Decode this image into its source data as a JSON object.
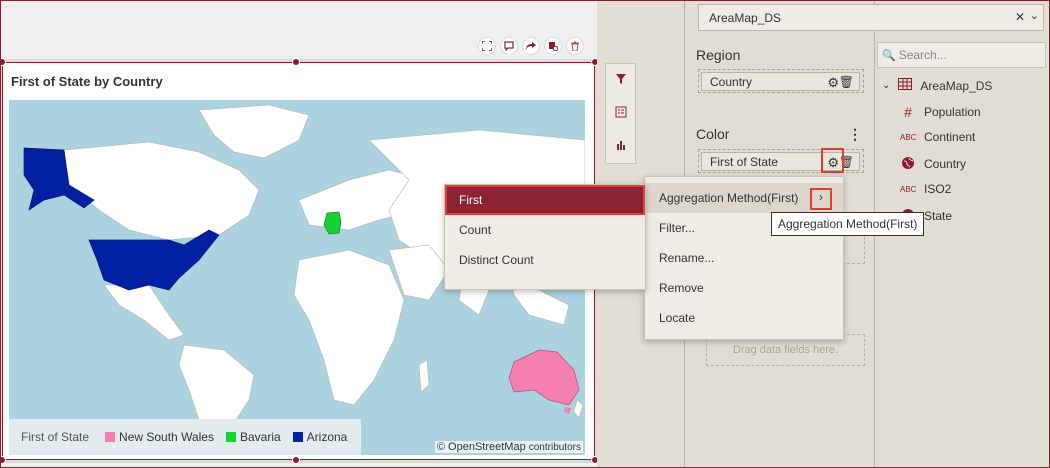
{
  "widget": {
    "title": "First of State by Country",
    "legend": {
      "title": "First of State",
      "items": [
        {
          "label": "New South Wales",
          "color": "#f47fb0"
        },
        {
          "label": "Bavaria",
          "color": "#19d133"
        },
        {
          "label": "Arizona",
          "color": "#0020a4"
        }
      ]
    },
    "attribution_prefix": "©",
    "attribution_link": "OpenStreetMap",
    "attribution_suffix": "contributors"
  },
  "datasource": {
    "selected": "AreaMap_DS"
  },
  "properties": {
    "region_label": "Region",
    "region_field": "Country",
    "color_label": "Color",
    "color_field": "First of State",
    "drop_hint": "Drag data fields here."
  },
  "fields_panel": {
    "search_placeholder": "Search...",
    "root": "AreaMap_DS",
    "items": [
      {
        "type": "#",
        "label": "Population"
      },
      {
        "type": "ABC",
        "label": "Continent"
      },
      {
        "type": "globe",
        "label": "Country"
      },
      {
        "type": "ABC",
        "label": "ISO2"
      },
      {
        "type": "globe",
        "label": "State"
      }
    ]
  },
  "context_menu": {
    "items": [
      "Aggregation Method(First)",
      "Filter...",
      "Rename...",
      "Remove",
      "Locate"
    ]
  },
  "aggregation_submenu": {
    "items": [
      "First",
      "Count",
      "Distinct Count"
    ],
    "selected": "First"
  },
  "tooltip": "Aggregation Method(First)",
  "colors": {
    "accent": "#8b1c2e",
    "panel": "#e2ddd2",
    "ocean": "#aad3df"
  }
}
